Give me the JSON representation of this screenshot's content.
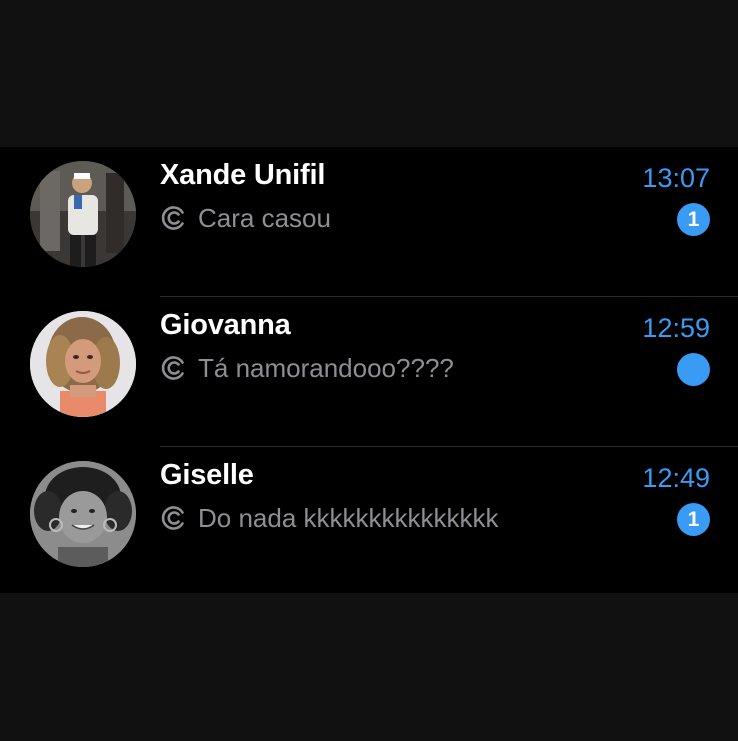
{
  "chats": [
    {
      "name": "Xande Unifil",
      "time": "13:07",
      "preview": "Cara casou",
      "unread": "1",
      "avatar": "avatar-photo-man-mirror-selfie",
      "status_icon": "double-circle-icon"
    },
    {
      "name": "Giovanna",
      "time": "12:59",
      "preview": "Tá namorandooo????",
      "unread": "",
      "avatar": "avatar-photo-woman-curly-hair",
      "status_icon": "double-circle-icon"
    },
    {
      "name": "Giselle",
      "time": "12:49",
      "preview": "Do nada kkkkkkkkkkkkkkk",
      "unread": "1",
      "avatar": "avatar-photo-woman-grayscale",
      "status_icon": "double-circle-icon"
    }
  ],
  "colors": {
    "accent": "#3a9bf5",
    "background": "#000000",
    "outer_background": "#111111",
    "preview_text": "#8e8e93",
    "divider": "#2a2a2c"
  }
}
